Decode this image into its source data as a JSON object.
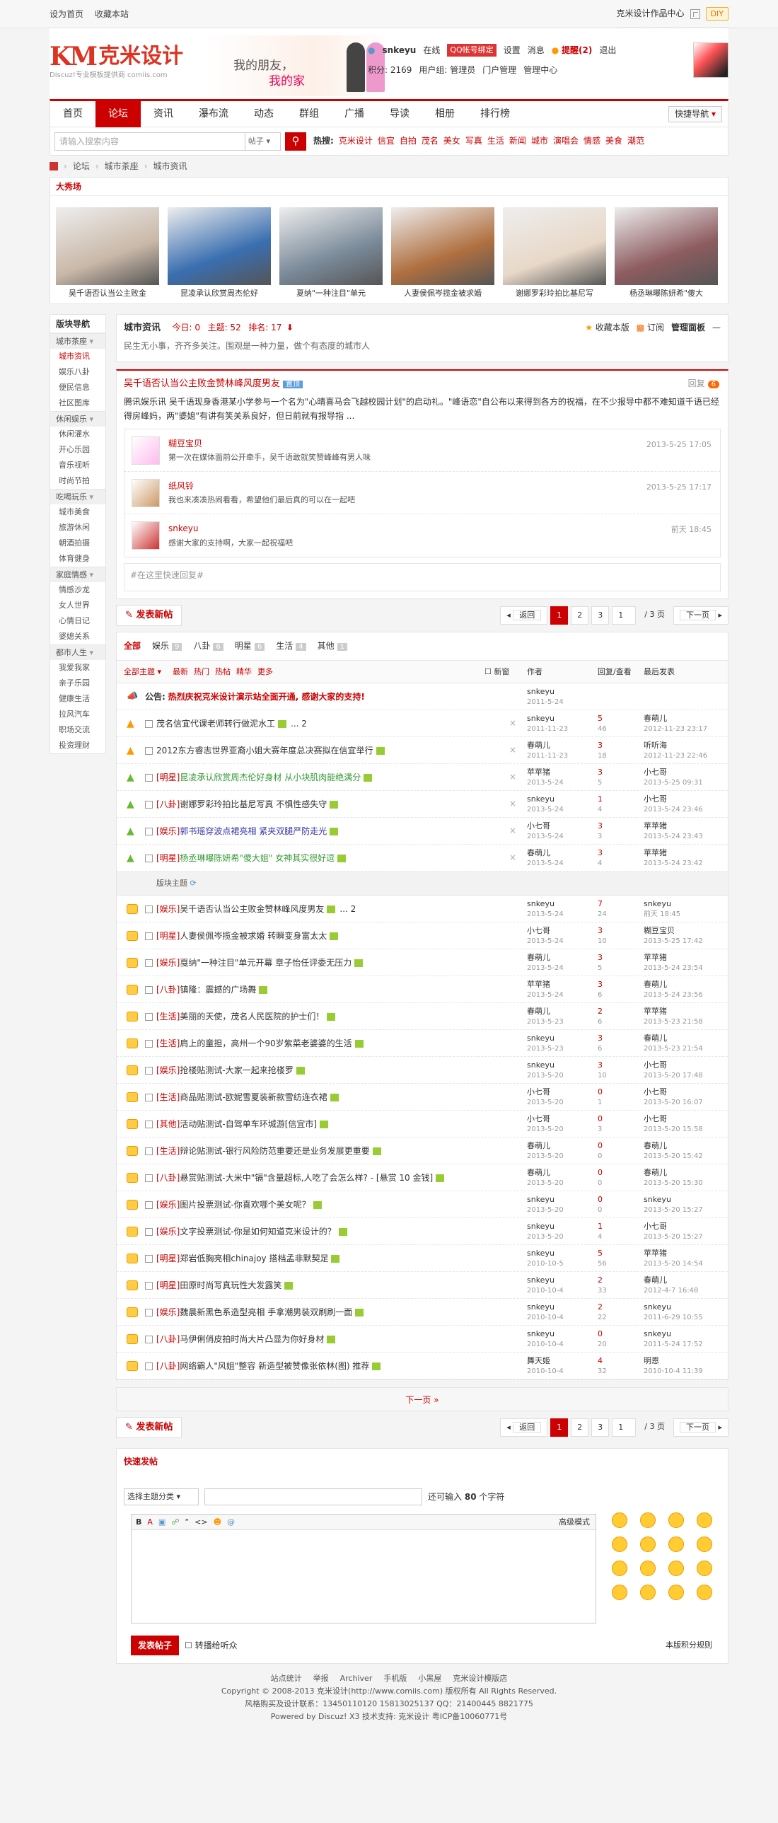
{
  "topbar": {
    "set_home": "设为首页",
    "favorite": "收藏本站",
    "works": "克米设计作品中心",
    "diy": "DIY"
  },
  "header": {
    "logo_main": "KM",
    "logo_cn": "克米设计",
    "logo_sub": "Discuz!专业模板提供商 comiis.com",
    "slogan1": "我的朋友，",
    "slogan2": "我的家",
    "username": "snkeyu",
    "online": "在线",
    "qq_bind": "QQ帐号绑定",
    "settings": "设置",
    "messages": "消息",
    "reminder": "提醒(2)",
    "logout": "退出",
    "points": "积分: 2169",
    "usergroup": "用户组: 管理员",
    "portal_manage": "门户管理",
    "manage_center": "管理中心"
  },
  "nav": {
    "items": [
      "首页",
      "论坛",
      "资讯",
      "瀑布流",
      "动态",
      "群组",
      "广播",
      "导读",
      "相册",
      "排行榜"
    ],
    "active": 1,
    "quick": "快捷导航"
  },
  "search": {
    "placeholder": "请输入搜索内容",
    "type": "帖子",
    "hot_label": "热搜:",
    "hot": [
      "克米设计",
      "信宜",
      "自拍",
      "茂名",
      "美女",
      "写真",
      "生活",
      "新闻",
      "城市",
      "演唱会",
      "情感",
      "美食",
      "潮范"
    ]
  },
  "breadcrumb": [
    "论坛",
    "城市茶座",
    "城市资讯"
  ],
  "showcase": {
    "title": "大秀场",
    "items": [
      {
        "caption": "吴千语否认当公主败金",
        "color": "#c9b8a8"
      },
      {
        "caption": "昆凌承认欣赏周杰伦好",
        "color": "#3a6fb0"
      },
      {
        "caption": "夏纳\"一种注目\"单元",
        "color": "#7a8a99"
      },
      {
        "caption": "人妻侯佩岑揽金被求婚",
        "color": "#b07040"
      },
      {
        "caption": "谢娜罗彩玲拍比基尼写",
        "color": "#e8d8c8"
      },
      {
        "caption": "杨丞琳曝陈妍希\"傻大",
        "color": "#8d5c60"
      }
    ]
  },
  "sidebar": {
    "title": "版块导航",
    "groups": [
      {
        "name": "城市茶座",
        "items": [
          "城市资讯",
          "娱乐八卦",
          "便民信息",
          "社区图库"
        ],
        "active": 0
      },
      {
        "name": "休闲娱乐",
        "items": [
          "休闲灌水",
          "开心乐园",
          "音乐视听",
          "时尚节拍"
        ]
      },
      {
        "name": "吃喝玩乐",
        "items": [
          "城市美食",
          "旅游休闲",
          "朝酒拍摄",
          "体育健身"
        ]
      },
      {
        "name": "家庭情感",
        "items": [
          "情感沙龙",
          "女人世界",
          "心情日记",
          "婆媳关系"
        ]
      },
      {
        "name": "都市人生",
        "items": [
          "我爱我家",
          "亲子乐园",
          "健康生活",
          "拉风汽车",
          "职场交流",
          "投资理财"
        ]
      }
    ]
  },
  "forum": {
    "name": "城市资讯",
    "today": "今日: 0",
    "topics": "主题: 52",
    "rank": "排名: 17",
    "desc": "民生无小事，齐齐多关注。围观是一种力量，做个有态度的城市人",
    "fav": "收藏本版",
    "rss": "订阅",
    "admin": "管理面板"
  },
  "featured": {
    "title": "吴千语否认当公主败金赞林峰风度男友",
    "tag": "置顶",
    "reply_label": "回复",
    "reply_count": "6",
    "text": "腾讯娱乐讯 吴千语现身香港某小学参与一个名为\"心晴喜马会飞越校园计划\"的启动礼。\"峰语恋\"自公布以来得到各方的祝福，在不少报导中都不难知道千语已经得房峰妈，两\"婆媳\"有讲有笑关系良好，但日前就有报导指 ...",
    "replies": [
      {
        "name": "糊豆宝贝",
        "content": "第一次在媒体面前公开牵手，吴千语敢就笑赞峰峰有男人味",
        "time": "2013-5-25 17:05"
      },
      {
        "name": "纸风铃",
        "content": "我也来凑凑热闹看看，希望他们最后真的可以在一起吧",
        "time": "2013-5-25 17:17"
      },
      {
        "name": "snkeyu",
        "content": "感谢大家的支持啊，大家一起祝福吧",
        "time": "前天 18:45"
      }
    ],
    "quick_reply": "#在这里快速回复#"
  },
  "pager": {
    "new_post": "发表新帖",
    "back": "返回",
    "pages": [
      "1",
      "2",
      "3"
    ],
    "current": "1",
    "total": "/ 3 页",
    "next": "下一页"
  },
  "types": [
    {
      "name": "全部",
      "count": ""
    },
    {
      "name": "娱乐",
      "count": "9"
    },
    {
      "name": "八卦",
      "count": "6"
    },
    {
      "name": "明星",
      "count": "6"
    },
    {
      "name": "生活",
      "count": "4"
    },
    {
      "name": "其他",
      "count": "1"
    }
  ],
  "list_head": {
    "all": "全部主题",
    "sorts": [
      "最新",
      "热门",
      "热帖",
      "精华",
      "更多"
    ],
    "newwin": "新窗",
    "author": "作者",
    "reply_view": "回复/查看",
    "last": "最后发表"
  },
  "announcement": {
    "label": "公告:",
    "text": "热烈庆祝克米设计演示站全面开通, 感谢大家的支持!",
    "author": "snkeyu",
    "date": "2011-5-24"
  },
  "sticky": [
    {
      "cat": "",
      "title": "茂名信宜代课老师转行做泥水工",
      "extra": "... 2",
      "author": "snkeyu",
      "date": "2011-11-23",
      "r": "5",
      "v": "46",
      "last": "春萌儿",
      "ltime": "2012-11-23 23:17",
      "icon": "#f90"
    },
    {
      "cat": "",
      "title": "2012东方睿志世界亚裔小姐大赛年度总决赛拟在信宜举行",
      "extra": "",
      "author": "春萌儿",
      "date": "2011-11-23",
      "r": "3",
      "v": "18",
      "last": "听听海",
      "ltime": "2012-11-23 22:46",
      "icon": "#f90"
    },
    {
      "cat": "[明星]",
      "title": "昆凌承认欣赏周杰伦好身材 从小块肌肉能绝满分",
      "extra": "",
      "author": "苹苹猪",
      "date": "2013-5-24",
      "r": "3",
      "v": "5",
      "last": "小七哥",
      "ltime": "2013-5-25 09:31",
      "icon": "#6b3"
    },
    {
      "cat": "[八卦]",
      "title": "谢娜罗彩玲拍比基尼写真 不惧性感失守",
      "extra": "",
      "author": "snkeyu",
      "date": "2013-5-24",
      "r": "1",
      "v": "4",
      "last": "小七哥",
      "ltime": "2013-5-24 23:46",
      "icon": "#6b3"
    },
    {
      "cat": "[娱乐]",
      "title": "郭书瑶穿波点裙亮相 紧夹双腿严防走光",
      "extra": "",
      "author": "小七哥",
      "date": "2013-5-24",
      "r": "3",
      "v": "3",
      "last": "苹苹猪",
      "ltime": "2013-5-24 23:43",
      "icon": "#6b3"
    },
    {
      "cat": "[明星]",
      "title": "杨丞琳曝陈妍希\"傻大姐\" 女神其实很好逗",
      "extra": "",
      "author": "春萌儿",
      "date": "2013-5-24",
      "r": "3",
      "v": "4",
      "last": "苹苹猪",
      "ltime": "2013-5-24 23:42",
      "icon": "#6b3"
    }
  ],
  "section_label": "版块主题",
  "threads": [
    {
      "cat": "[娱乐]",
      "title": "吴千语否认当公主败金赞林峰风度男友",
      "extra": "... 2",
      "author": "snkeyu",
      "date": "2013-5-24",
      "r": "7",
      "v": "24",
      "last": "snkeyu",
      "ltime": "前天 18:45"
    },
    {
      "cat": "[明星]",
      "title": "人妻侯佩岑揽金被求婚 转瞬变身富太太",
      "extra": "",
      "author": "小七哥",
      "date": "2013-5-24",
      "r": "3",
      "v": "10",
      "last": "糊豆宝贝",
      "ltime": "2013-5-25 17:42"
    },
    {
      "cat": "[娱乐]",
      "title": "戛纳\"一种注目\"单元开幕 章子怡任评委无压力",
      "extra": "",
      "author": "春萌儿",
      "date": "2013-5-24",
      "r": "3",
      "v": "5",
      "last": "苹苹猪",
      "ltime": "2013-5-24 23:54"
    },
    {
      "cat": "[八卦]",
      "title": "镇隆：震撼的广场舞",
      "extra": "",
      "author": "苹苹猪",
      "date": "2013-5-24",
      "r": "3",
      "v": "6",
      "last": "春萌儿",
      "ltime": "2013-5-24 23:56"
    },
    {
      "cat": "[生活]",
      "title": "美丽的天使，茂名人民医院的护士们！",
      "extra": "",
      "author": "春萌儿",
      "date": "2013-5-23",
      "r": "2",
      "v": "6",
      "last": "苹苹猪",
      "ltime": "2013-5-23 21:58"
    },
    {
      "cat": "[生活]",
      "title": "肩上的童担，高州一个90岁紫菜老婆婆的生活",
      "extra": "",
      "author": "snkeyu",
      "date": "2013-5-23",
      "r": "3",
      "v": "6",
      "last": "春萌儿",
      "ltime": "2013-5-23 21:54"
    },
    {
      "cat": "[娱乐]",
      "title": "抢楼贴测试-大家一起来抢楼罗",
      "extra": "",
      "author": "snkeyu",
      "date": "2013-5-20",
      "r": "3",
      "v": "10",
      "last": "小七哥",
      "ltime": "2013-5-20 17:48"
    },
    {
      "cat": "[生活]",
      "title": "商品贴测试-欧妮雪夏装新款雪纺连衣裙",
      "extra": "",
      "author": "小七哥",
      "date": "2013-5-20",
      "r": "0",
      "v": "1",
      "last": "小七哥",
      "ltime": "2013-5-20 16:07"
    },
    {
      "cat": "[其他]",
      "title": "活动贴测试-自驾单车环城游[信宜市]",
      "extra": "",
      "author": "小七哥",
      "date": "2013-5-20",
      "r": "0",
      "v": "3",
      "last": "小七哥",
      "ltime": "2013-5-20 15:58"
    },
    {
      "cat": "[生活]",
      "title": "辩论贴测试-银行风险防范重要还是业务发展更重要",
      "extra": "",
      "author": "春萌儿",
      "date": "2013-5-20",
      "r": "0",
      "v": "0",
      "last": "春萌儿",
      "ltime": "2013-5-20 15:42"
    },
    {
      "cat": "[八卦]",
      "title": "悬赏贴测试-大米中\"镉\"含量超标,人吃了会怎么样? - [悬赏 10 金钱]",
      "extra": "",
      "author": "春萌儿",
      "date": "2013-5-20",
      "r": "0",
      "v": "0",
      "last": "春萌儿",
      "ltime": "2013-5-20 15:30"
    },
    {
      "cat": "[娱乐]",
      "title": "图片投票测试-你喜欢哪个美女呢？",
      "extra": "",
      "author": "snkeyu",
      "date": "2013-5-20",
      "r": "0",
      "v": "0",
      "last": "snkeyu",
      "ltime": "2013-5-20 15:27"
    },
    {
      "cat": "[娱乐]",
      "title": "文字投票测试-你是如何知道克米设计的？",
      "extra": "",
      "author": "snkeyu",
      "date": "2013-5-20",
      "r": "1",
      "v": "4",
      "last": "小七哥",
      "ltime": "2013-5-20 15:27"
    },
    {
      "cat": "[明星]",
      "title": "郑岩低胸亮相chinajoy 搭档孟非默契足",
      "extra": "",
      "author": "snkeyu",
      "date": "2010-10-5",
      "r": "5",
      "v": "56",
      "last": "苹苹猪",
      "ltime": "2013-5-20 14:54"
    },
    {
      "cat": "[明星]",
      "title": "田原时尚写真玩性大发露笑",
      "extra": "",
      "author": "snkeyu",
      "date": "2010-10-4",
      "r": "2",
      "v": "33",
      "last": "春萌儿",
      "ltime": "2012-4-7 16:48"
    },
    {
      "cat": "[娱乐]",
      "title": "魏晨新黑色系造型亮相 手拿潮男装双刷刷一面",
      "extra": "",
      "author": "snkeyu",
      "date": "2010-10-4",
      "r": "2",
      "v": "22",
      "last": "snkeyu",
      "ltime": "2011-6-29 10:55"
    },
    {
      "cat": "[八卦]",
      "title": "马伊俐俏皮拍时尚大片凸显为你好身材",
      "extra": "",
      "author": "snkeyu",
      "date": "2010-10-4",
      "r": "0",
      "v": "20",
      "last": "snkeyu",
      "ltime": "2011-5-24 17:52"
    },
    {
      "cat": "[八卦]",
      "title": "网络霸人\"风姐\"整容 新造型被赞像张依林(图) 推荐",
      "extra": "",
      "author": "舞天姬",
      "date": "2010-10-4",
      "r": "4",
      "v": "32",
      "last": "明恩",
      "ltime": "2010-10-4 11:39"
    }
  ],
  "next_page": "下一页 »",
  "quickpost": {
    "title": "快速发帖",
    "category": "选择主题分类",
    "limit_a": "还可输入",
    "limit_n": "80",
    "limit_b": "个字符",
    "advanced": "高级模式",
    "submit": "发表帖子",
    "sync": "转播给听众",
    "rule": "本版积分规则"
  },
  "footer": {
    "links": [
      "站点统计",
      "举报",
      "Archiver",
      "手机版",
      "小黑屋",
      "克米设计模版店"
    ],
    "copyright": "Copyright © 2008-2013 克米设计(http://www.comiis.com) 版权所有 All Rights Reserved.",
    "contact": "风格购买及设计联系：13450110120 15813025137 QQ：21400445 8821775",
    "powered": "Powered by Discuz! X3  技术支持: 克米设计 粤ICP备10060771号"
  }
}
